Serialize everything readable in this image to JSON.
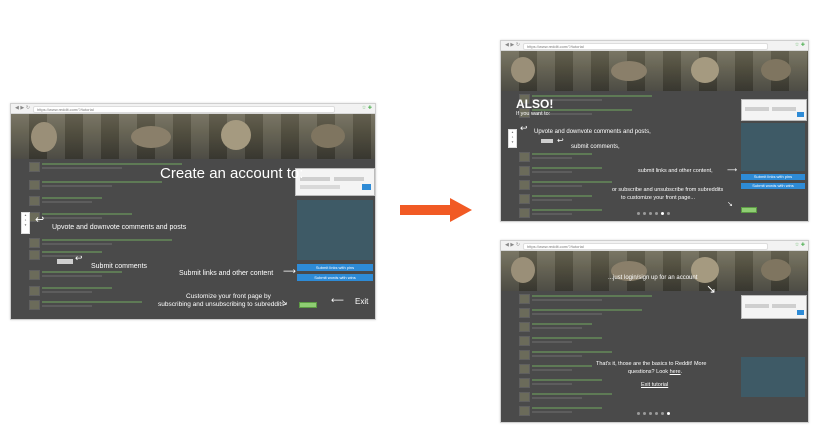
{
  "browser": {
    "url": "https://www.reddit.com/?/tutorial"
  },
  "left": {
    "title": "Create an account to:",
    "upvote": "Upvote and downvote comments and posts",
    "submit_comments": "Submit comments",
    "submit_links": "Submit links and other content",
    "customize_1": "Customize your front page by",
    "customize_2": "subscribing and unsubscribing to subreddits",
    "exit": "Exit",
    "btn_links": "Submit links with pins",
    "btn_words": "Submit words with wins"
  },
  "top_right": {
    "title": "ALSO!",
    "subtitle": "If you want to:",
    "upvote": "Upvote and downvote comments and posts,",
    "submit_comments": "submit comments,",
    "submit_links": "submit links and other content,",
    "subscribe_1": "or subscribe and unsubscribe from subreddits",
    "subscribe_2": "to customize your front page...",
    "btn_links": "Submit links with pins",
    "btn_words": "Submit words with wins"
  },
  "bottom_right": {
    "login": "...just login/sign up for an account",
    "basics_1": "That's it, those are the basics to Reddit! More",
    "basics_2": "questions? Look",
    "basics_link": "here",
    "basics_end": ".",
    "exit_tutorial": "Exit tutorial"
  },
  "colors": {
    "arrow": "#f15a24",
    "overlay": "#4a4a4a",
    "button": "#2e8bd6"
  },
  "icons": [
    "back-icon",
    "forward-icon",
    "reload-icon",
    "extension-icon",
    "curved-arrow-icon",
    "big-right-arrow-icon"
  ],
  "pagination": {
    "top_right_active": 5,
    "bottom_right_active": 6,
    "total": 6
  }
}
